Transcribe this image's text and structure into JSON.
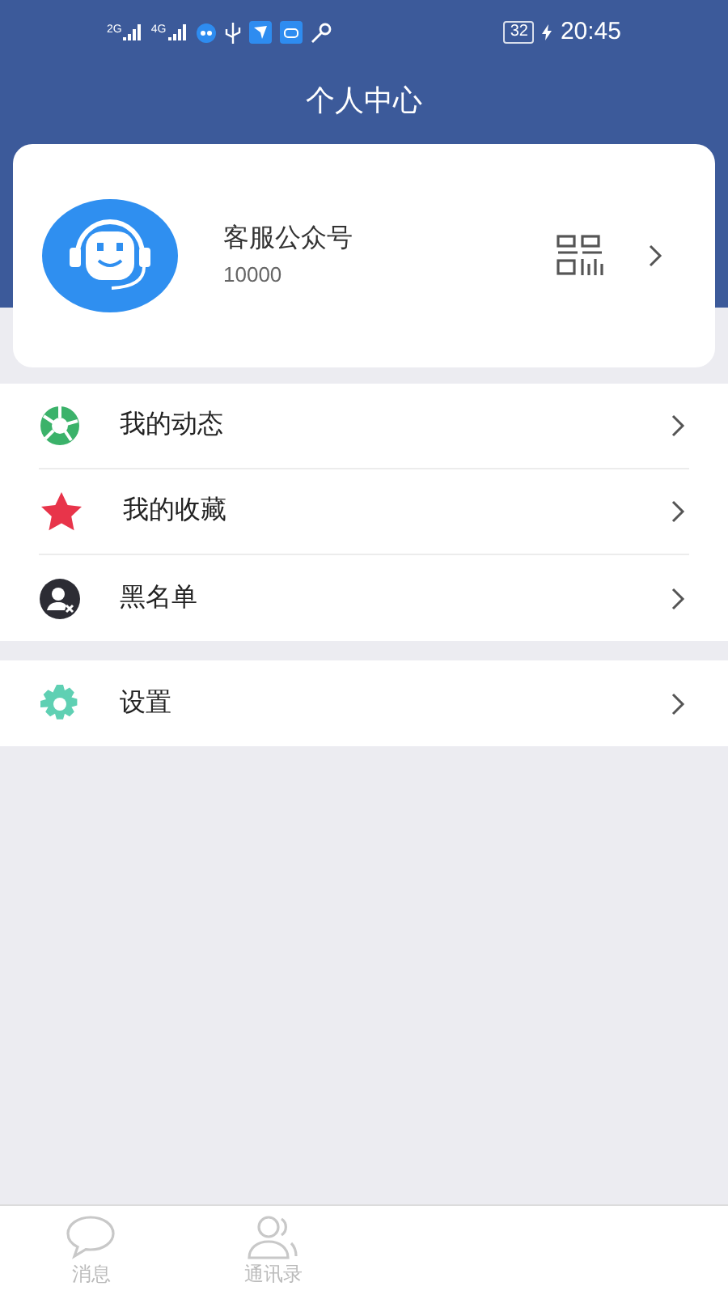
{
  "status_bar": {
    "network_1": "2G",
    "network_2": "4G",
    "battery": "32",
    "time": "20:45"
  },
  "header": {
    "title": "个人中心"
  },
  "profile": {
    "name": "客服公众号",
    "id": "10000"
  },
  "menu_groups": [
    {
      "items": [
        {
          "kind": "moments",
          "label": "我的动态"
        },
        {
          "kind": "favorites",
          "label": "我的收藏"
        },
        {
          "kind": "blacklist",
          "label": "黑名单"
        }
      ]
    },
    {
      "items": [
        {
          "kind": "settings",
          "label": "设置"
        }
      ]
    }
  ],
  "tab_bar": [
    {
      "kind": "chat",
      "label": "消息",
      "selected": false
    },
    {
      "kind": "contacts",
      "label": "通讯录",
      "selected": false
    }
  ]
}
